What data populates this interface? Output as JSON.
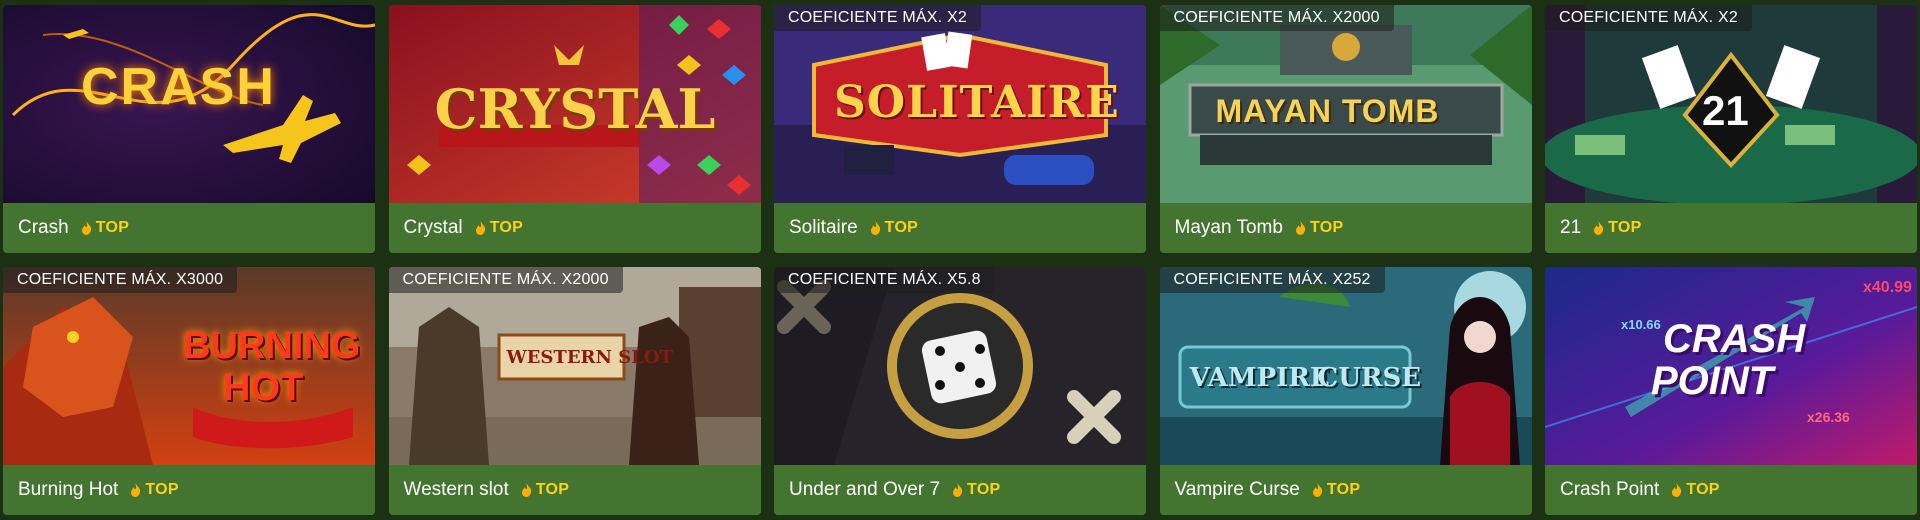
{
  "tag_label": "TOP",
  "games": [
    {
      "name": "Crash",
      "coef": "",
      "art_title": "CRASH"
    },
    {
      "name": "Crystal",
      "coef": "",
      "art_title": "CRYSTAL"
    },
    {
      "name": "Solitaire",
      "coef": "COEFICIENTE MÁX. X2",
      "art_title": "SOLITAIRE"
    },
    {
      "name": "Mayan Tomb",
      "coef": "COEFICIENTE MÁX. X2000",
      "art_title": "MAYAN TOMB"
    },
    {
      "name": "21",
      "coef": "COEFICIENTE MÁX. X2",
      "art_title": "21"
    },
    {
      "name": "Burning Hot",
      "coef": "COEFICIENTE MÁX. X3000",
      "art_title": "BURNING",
      "art_title2": "HOT"
    },
    {
      "name": "Western slot",
      "coef": "COEFICIENTE MÁX. X2000",
      "art_title": "WESTERN SLOT"
    },
    {
      "name": "Under and Over 7",
      "coef": "COEFICIENTE MÁX. X5.8",
      "art_title": ""
    },
    {
      "name": "Vampire Curse",
      "coef": "COEFICIENTE MÁX. X252",
      "art_title": "VAMPIRE",
      "art_title2": "CURSE"
    },
    {
      "name": "Crash Point",
      "coef": "",
      "art_title": "CRASH",
      "art_title2": "POINT",
      "mult_a": "x10.66",
      "mult_b": "x40.99",
      "mult_c": "x26.36"
    }
  ],
  "colors": {
    "page_bg": "#1c3014",
    "footer_bg": "#437430",
    "top_badge": "#ffd21c",
    "flame": "#ffb000"
  },
  "icons": {
    "flame": "flame-icon"
  }
}
